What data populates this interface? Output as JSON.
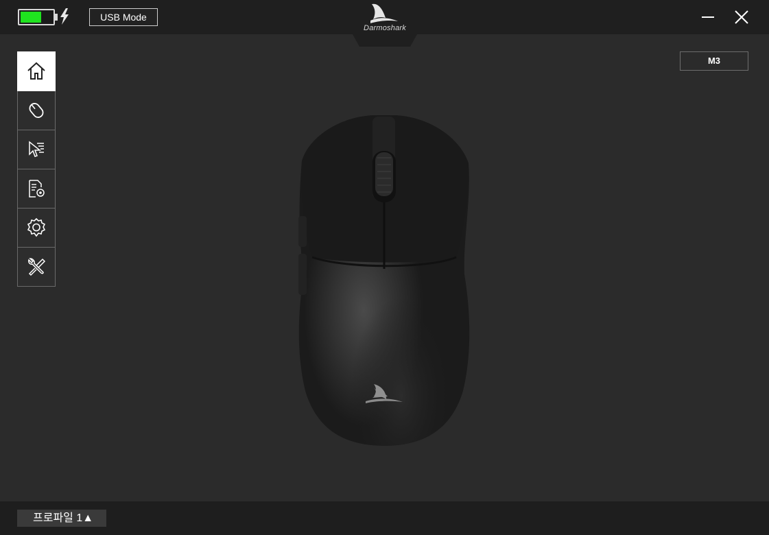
{
  "header": {
    "battery_level": 0.65,
    "battery_color": "#1fe31f",
    "charging_icon": "lightning-bolt-icon",
    "mode_label": "USB Mode",
    "brand": "Darmoshark"
  },
  "window_controls": {
    "minimize_icon": "minimize-icon",
    "close_icon": "close-icon"
  },
  "sidebar": {
    "items": [
      {
        "icon": "home-icon",
        "active": true
      },
      {
        "icon": "mouse-icon",
        "active": false
      },
      {
        "icon": "pointer-icon",
        "active": false
      },
      {
        "icon": "document-settings-icon",
        "active": false
      },
      {
        "icon": "gear-icon",
        "active": false
      },
      {
        "icon": "tools-icon",
        "active": false
      }
    ]
  },
  "device": {
    "model": "M3"
  },
  "footer": {
    "profile_label": "프로파일 1▲"
  }
}
